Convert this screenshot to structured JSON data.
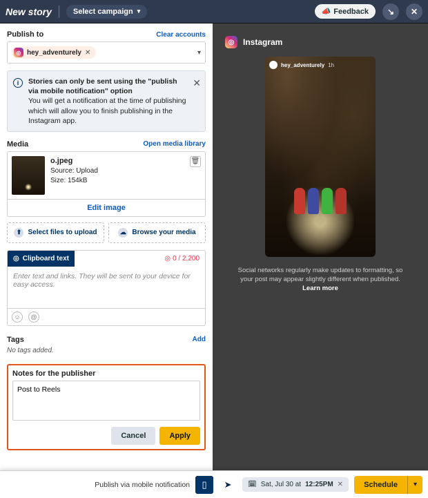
{
  "header": {
    "title": "New story",
    "campaign_label": "Select campaign",
    "feedback_label": "Feedback"
  },
  "publish": {
    "label": "Publish to",
    "clear_link": "Clear accounts",
    "account_handle": "hey_adventurely"
  },
  "info": {
    "bold": "Stories can only be sent using the \"publish via mobile notification\" option",
    "body": "You will get a notification at the time of publishing which will allow you to finish publishing in the Instagram app."
  },
  "media": {
    "label": "Media",
    "open_link": "Open media library",
    "file_name": "o.jpeg",
    "source_line": "Source: Upload",
    "size_line": "Size: 154kB",
    "edit_label": "Edit image",
    "select_files": "Select files to upload",
    "browse_media": "Browse your media"
  },
  "clipboard": {
    "tab_label": "Clipboard text",
    "counter": "0 / 2,200",
    "placeholder": "Enter text and links. They will be sent to your device for easy access."
  },
  "tags": {
    "label": "Tags",
    "add_link": "Add",
    "none": "No tags added."
  },
  "notes": {
    "label": "Notes for the publisher",
    "value": "Post to Reels",
    "cancel": "Cancel",
    "apply": "Apply"
  },
  "preview": {
    "network_name": "Instagram",
    "story_handle": "hey_adventurely",
    "story_time": "1h",
    "disclaimer_text": "Social networks regularly make updates to formatting, so your post may appear slightly different when published. ",
    "learn_more": "Learn more"
  },
  "bottom": {
    "mode_text": "Publish via mobile notification",
    "date_text_prefix": "Sat, Jul 30 at ",
    "date_text_time": "12:25PM",
    "schedule_label": "Schedule"
  }
}
